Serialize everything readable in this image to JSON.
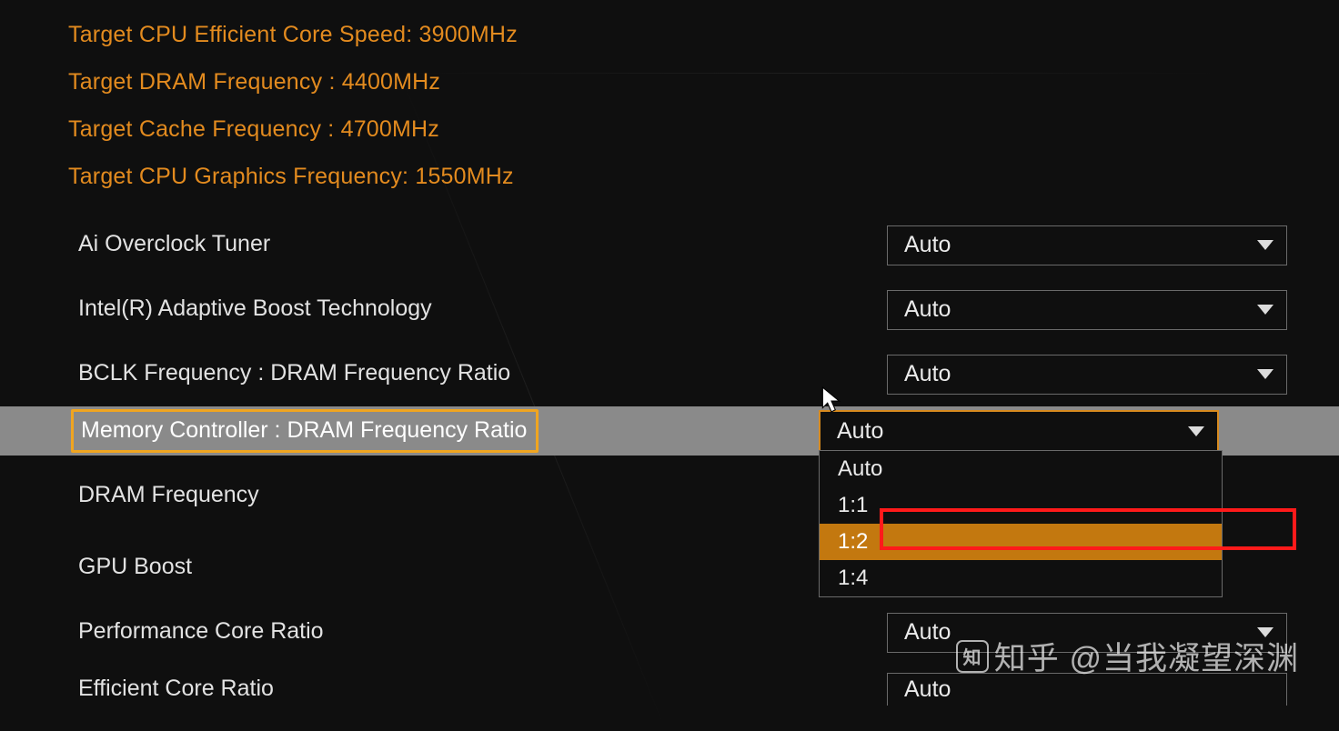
{
  "targets": {
    "cpu_eff_core_speed": "Target CPU Efficient Core Speed: 3900MHz",
    "dram_freq": "Target DRAM Frequency : 4400MHz",
    "cache_freq": "Target Cache Frequency : 4700MHz",
    "gpu_freq": "Target CPU Graphics Frequency: 1550MHz"
  },
  "settings": {
    "ai_overclock": {
      "label": "Ai Overclock Tuner",
      "value": "Auto"
    },
    "intel_abt": {
      "label": "Intel(R) Adaptive Boost Technology",
      "value": "Auto"
    },
    "bclk_dram_ratio": {
      "label": "BCLK Frequency : DRAM Frequency Ratio",
      "value": "Auto"
    },
    "mc_dram_ratio": {
      "label": "Memory Controller : DRAM Frequency Ratio",
      "value": "Auto",
      "options": [
        "Auto",
        "1:1",
        "1:2",
        "1:4"
      ],
      "highlighted_option": "1:2"
    },
    "dram_frequency": {
      "label": "DRAM Frequency"
    },
    "gpu_boost": {
      "label": "GPU Boost"
    },
    "performance_core_ratio": {
      "label": "Performance Core Ratio",
      "value": "Auto"
    },
    "efficient_core_ratio": {
      "label": "Efficient Core Ratio",
      "value": "Auto"
    }
  },
  "watermark": "知乎 @当我凝望深渊"
}
